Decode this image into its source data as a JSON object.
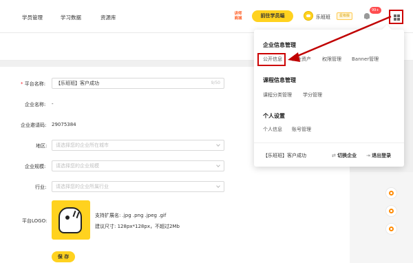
{
  "nav": {
    "items": [
      "学员管理",
      "学习数据",
      "资源库"
    ]
  },
  "header": {
    "mall_label": "讲师商城",
    "go_student_label": "前往学员端",
    "user_name": "乐班班",
    "vip_label": "星级版",
    "notification_count": "99+"
  },
  "form": {
    "platform_name_label": "平台名称:",
    "platform_name_value": "【乐班班】客户成功",
    "platform_name_counter": "9/50",
    "company_name_label": "企业名称:",
    "company_name_value": "-",
    "invite_code_label": "企业邀请码:",
    "invite_code_value": "29075384",
    "region_label": "地区:",
    "region_placeholder": "请选择您的企业所在城市",
    "scale_label": "企业规模:",
    "scale_placeholder": "请选择您的企业规模",
    "industry_label": "行业:",
    "industry_placeholder": "请选择您的企业所属行业",
    "logo_label": "平台LOGO:",
    "logo_ext_hint": "支持扩展名: .jpg .png .jpeg .gif",
    "logo_size_hint": "建议尺寸: 128px*128px，不超过2Mb",
    "save_label": "保 存"
  },
  "dropdown": {
    "enterprise_title": "企业信息管理",
    "enterprise_links": [
      "公开信息",
      "企业资产",
      "权限管理",
      "Banner管理"
    ],
    "course_title": "课程信息管理",
    "course_links": [
      "课程分类管理",
      "学分管理"
    ],
    "personal_title": "个人设置",
    "personal_links": [
      "个人信息",
      "账号管理"
    ],
    "org_name": "【乐班班】客户成功",
    "switch_label": "切换企业",
    "logout_label": "退出登录"
  },
  "colors": {
    "accent": "#ffd21f",
    "annotation": "#c00000",
    "required": "#f5222d"
  },
  "icons": [
    "apps-grid-icon",
    "bell-icon",
    "headset-icon",
    "phone-icon",
    "compass-icon",
    "switch-icon",
    "logout-icon"
  ]
}
